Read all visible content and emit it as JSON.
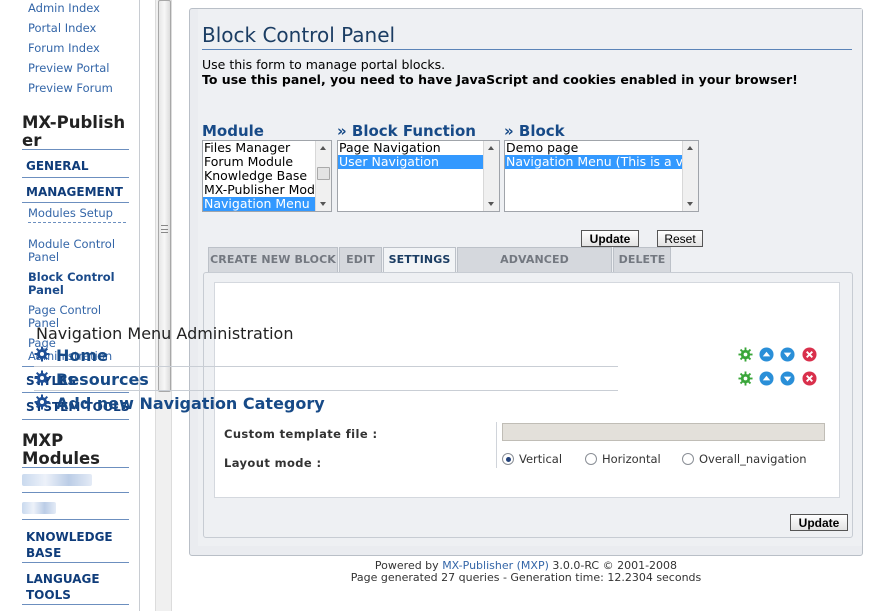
{
  "sidebar": {
    "top_links": [
      {
        "label": "Admin Index"
      },
      {
        "label": "Portal Index"
      },
      {
        "label": "Forum Index"
      },
      {
        "label": "Preview Portal"
      },
      {
        "label": "Preview Forum"
      }
    ],
    "mxp_title": "MX-Publisher",
    "sections": {
      "general": "GENERAL",
      "management": "MANAGEMENT",
      "modules_setup": "Modules Setup",
      "module_control": "Module Control Panel",
      "block_control": "Block Control Panel",
      "page_control": "Page Control Panel",
      "page_admin": "Page Administration",
      "styles": "STYLES",
      "system_tools": "SYSTEM TOOLS"
    },
    "mxp_modules_title": "MXP Modules",
    "module_links": {
      "knowledge_base": "KNOWLEDGE BASE",
      "language_tools": "LANGUAGE TOOLS"
    }
  },
  "panel": {
    "title": "Block Control Panel",
    "intro": "Use this form to manage portal blocks.",
    "warning": "To use this panel, you need to have JavaScript and cookies enabled in your browser!"
  },
  "selectors": {
    "module": {
      "label": "Module",
      "options": [
        "Files Manager",
        "Forum Module",
        "Knowledge Base",
        "MX-Publisher Mod",
        "Navigation Menu"
      ],
      "selected": "Navigation Menu"
    },
    "block_function": {
      "label": "» Block Function",
      "options": [
        "Page Navigation",
        "User Navigation"
      ],
      "selected": "User Navigation"
    },
    "block": {
      "label": "» Block",
      "options": [
        "Demo page",
        "Navigation Menu (This is a v"
      ],
      "selected": "Navigation Menu (This is a v"
    }
  },
  "buttons": {
    "update": "Update",
    "reset": "Reset",
    "update_bottom": "Update"
  },
  "tabs": [
    {
      "label": "CREATE NEW BLOCK",
      "active": false
    },
    {
      "label": "EDIT",
      "active": false
    },
    {
      "label": "SETTINGS",
      "active": true
    },
    {
      "label": "ADVANCED PERMISSIONS",
      "active": false
    },
    {
      "label": "DELETE",
      "active": false
    }
  ],
  "settings": {
    "nav_admin_title": "Navigation Menu Administration",
    "categories": [
      {
        "label": "Home",
        "icon": "gear-icon"
      },
      {
        "label": "Resources",
        "icon": "gear-icon"
      }
    ],
    "add_category": "Add new Navigation Category",
    "row_action_icons": [
      "edit-gear-icon",
      "move-up-icon",
      "move-down-icon",
      "delete-icon"
    ],
    "custom_template_label": "Custom template file :",
    "custom_template_value": "",
    "layout_mode_label": "Layout mode :",
    "layout_options": [
      {
        "label": "Vertical",
        "checked": true
      },
      {
        "label": "Horizontal",
        "checked": false
      },
      {
        "label": "Overall_navigation",
        "checked": false
      }
    ]
  },
  "footer": {
    "powered_prefix": "Powered by ",
    "brand": "MX-Publisher (MXP)",
    "powered_suffix": " 3.0.0-RC © 2001-2008",
    "stats": "Page generated 27 queries - Generation time: 12.2304 seconds"
  },
  "colors": {
    "accent": "#174a87",
    "selection": "#3399ff",
    "icon_green": "#3aa63a",
    "icon_blue": "#2a8fd8",
    "icon_red": "#d9304c"
  }
}
